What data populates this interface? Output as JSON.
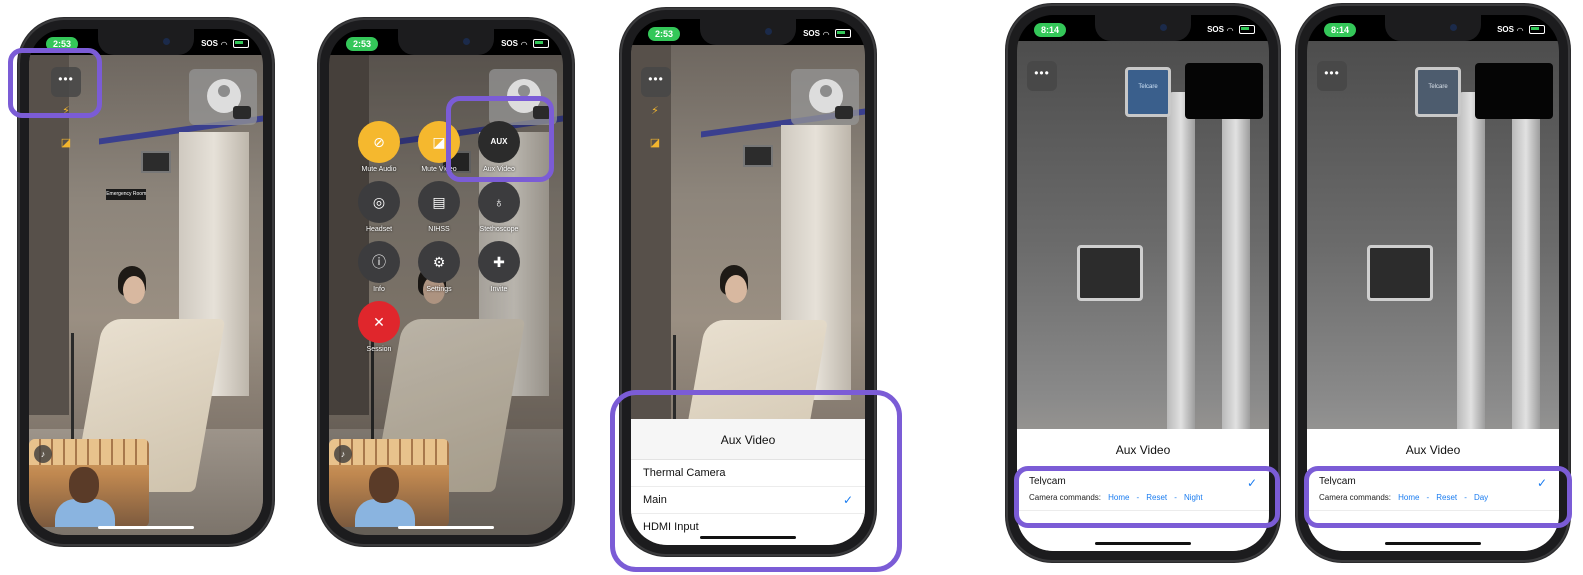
{
  "phones": [
    {
      "time": "2:53",
      "status": "SOS"
    },
    {
      "time": "2:53",
      "status": "SOS"
    },
    {
      "time": "2:53",
      "status": "SOS"
    },
    {
      "time": "8:14",
      "status": "SOS"
    },
    {
      "time": "8:14",
      "status": "SOS"
    }
  ],
  "overflow_button": "•••",
  "room_sign": "Emergency Room",
  "monitor_brand": "Telcare",
  "menu": {
    "mute_audio": "Mute Audio",
    "mute_video": "Mute Video",
    "aux_video": "Aux Video",
    "aux_icon": "AUX",
    "headset": "Headset",
    "nihss": "NIHSS",
    "stethoscope": "Stethoscope",
    "info": "Info",
    "settings": "Settings",
    "invite": "Invite",
    "end_session": "Session"
  },
  "aux_sheet": {
    "title": "Aux Video",
    "options": [
      "Thermal Camera",
      "Main",
      "HDMI Input"
    ],
    "selected": "Main"
  },
  "telycam_sheet_night": {
    "title": "Aux Video",
    "option": "Telycam",
    "commands_label": "Camera commands:",
    "commands": [
      "Home",
      "Reset",
      "Night"
    ]
  },
  "telycam_sheet_day": {
    "title": "Aux Video",
    "option": "Telycam",
    "commands_label": "Camera commands:",
    "commands": [
      "Home",
      "Reset",
      "Day"
    ]
  },
  "separator": "-",
  "checkmark": "✓",
  "colors": {
    "highlight": "#7b5cd6",
    "accent": "#1a7cf0",
    "mute": "#f5b82e",
    "end": "#e0262c",
    "time_pill": "#34c759"
  }
}
